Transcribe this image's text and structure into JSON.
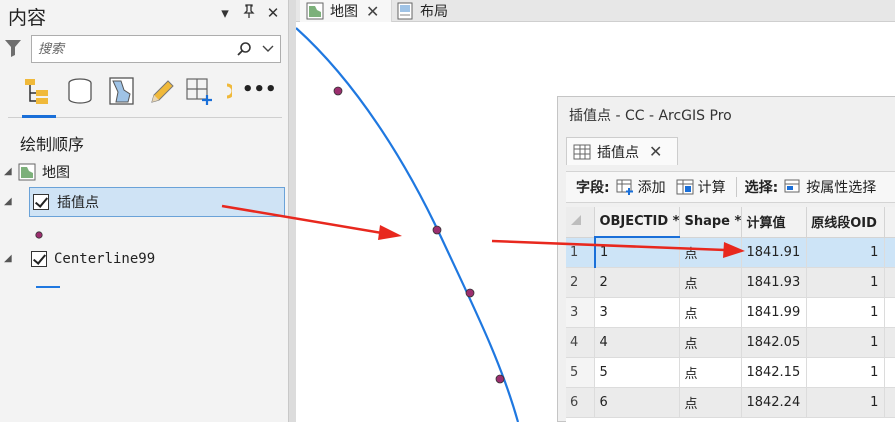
{
  "contents": {
    "title": "内容",
    "controls": {
      "menu": "▾",
      "pin": "ᵽ",
      "close": "✕"
    },
    "search_placeholder": "搜索",
    "section_title": "绘制顺序",
    "map_label": "地图",
    "layer_insert": "插值点",
    "layer_centerline": "Centerline99"
  },
  "tabs": {
    "map": "地图",
    "layout": "布局"
  },
  "table_window": {
    "title": "插值点 - CC - ArcGIS Pro",
    "tab_label": "插值点",
    "toolbar": {
      "fields_label": "字段:",
      "add": "添加",
      "calculate": "计算",
      "select_label": "选择:",
      "select_by_attr": "按属性选择"
    },
    "columns": [
      "OBJECTID *",
      "Shape *",
      "计算值",
      "原线段OID"
    ],
    "rows": [
      {
        "n": "1",
        "oid": "1",
        "shape": "点",
        "calc": "1841.91",
        "orig": "1"
      },
      {
        "n": "2",
        "oid": "2",
        "shape": "点",
        "calc": "1841.93",
        "orig": "1"
      },
      {
        "n": "3",
        "oid": "3",
        "shape": "点",
        "calc": "1841.99",
        "orig": "1"
      },
      {
        "n": "4",
        "oid": "4",
        "shape": "点",
        "calc": "1842.05",
        "orig": "1"
      },
      {
        "n": "5",
        "oid": "5",
        "shape": "点",
        "calc": "1842.15",
        "orig": "1"
      },
      {
        "n": "6",
        "oid": "6",
        "shape": "点",
        "calc": "1842.24",
        "orig": "1"
      }
    ]
  },
  "colors": {
    "line": "#1f78e0",
    "point": "#9b2e6e",
    "arrow": "#e8281e",
    "selection": "#cde4f7"
  }
}
